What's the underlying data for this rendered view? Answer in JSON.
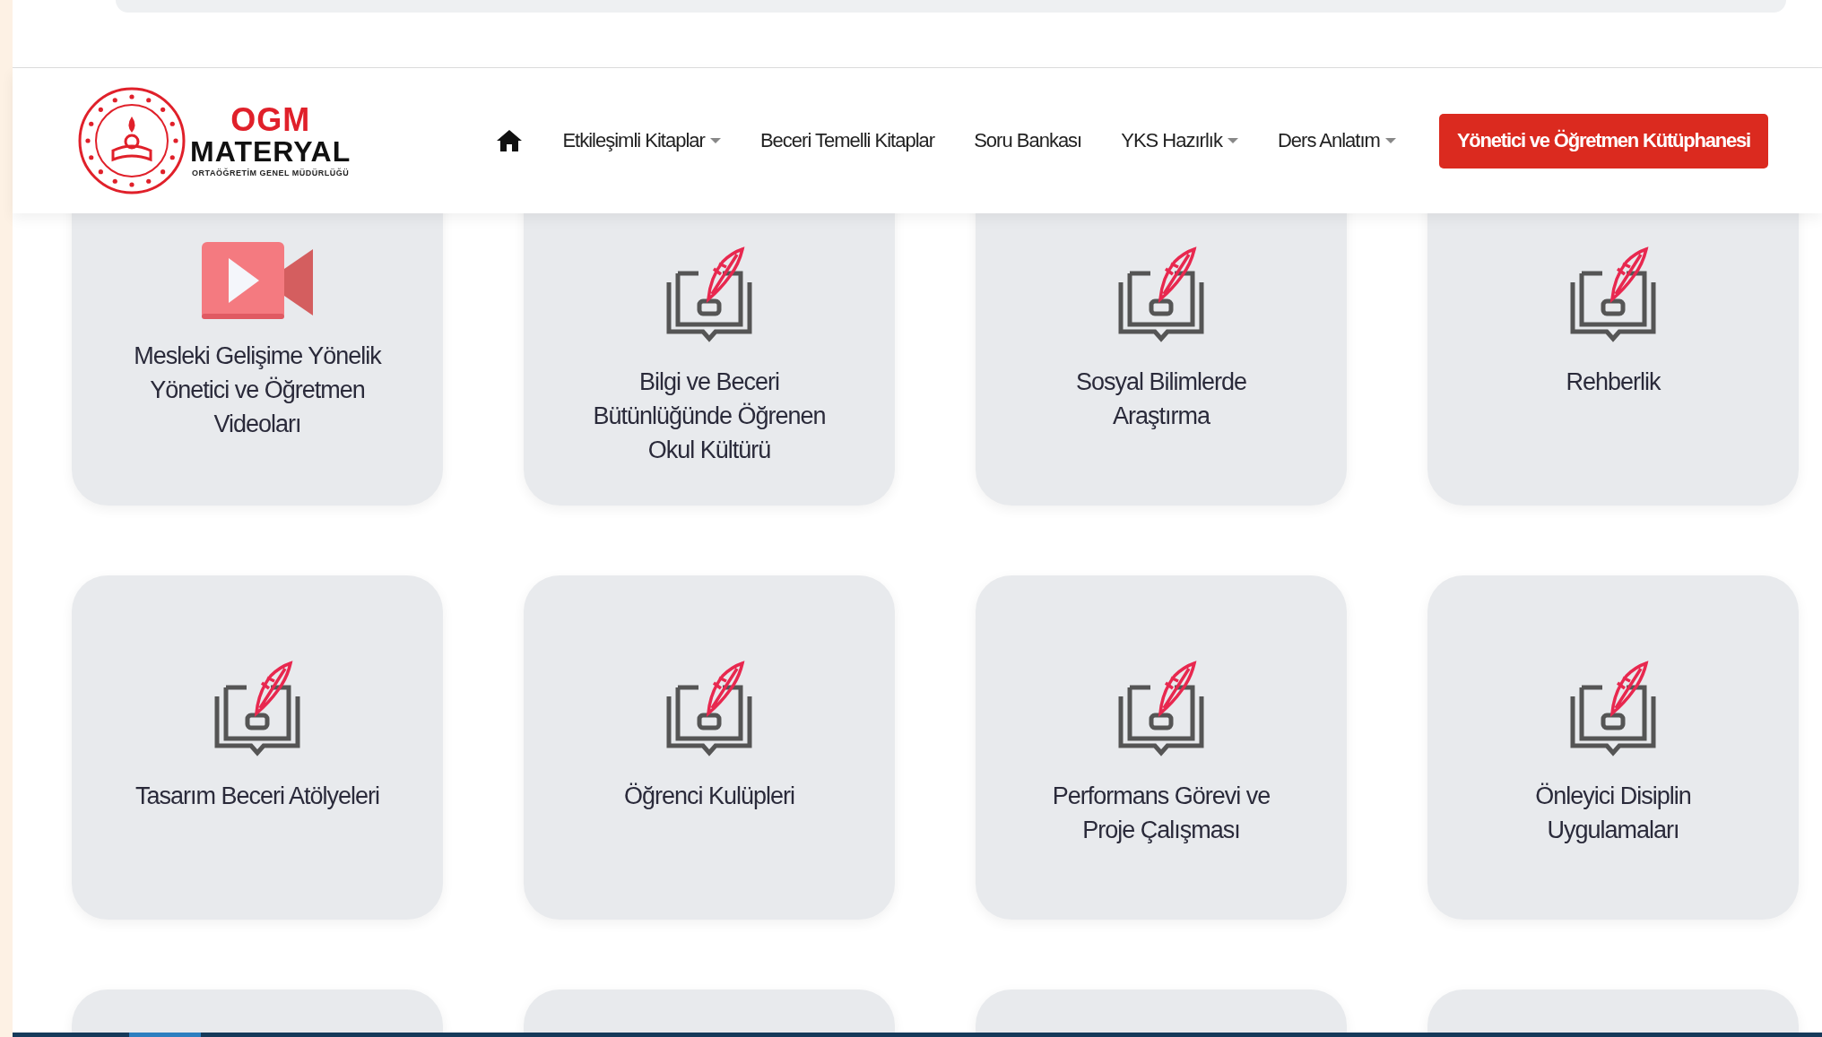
{
  "logo": {
    "title": "OGM",
    "subtitle": "MATERYAL",
    "tagline": "ORTAÖĞRETİM GENEL MÜDÜRLÜĞÜ"
  },
  "nav": [
    {
      "kind": "home"
    },
    {
      "kind": "link",
      "label": "Etkileşimli Kitaplar",
      "dropdown": true
    },
    {
      "kind": "link",
      "label": "Beceri Temelli Kitaplar",
      "dropdown": false
    },
    {
      "kind": "link",
      "label": "Soru Bankası",
      "dropdown": false
    },
    {
      "kind": "link",
      "label": "YKS Hazırlık",
      "dropdown": true
    },
    {
      "kind": "link",
      "label": "Ders Anlatım",
      "dropdown": true
    }
  ],
  "cta": "Yönetici ve Öğretmen Kütüphanesi",
  "cards": [
    {
      "kind": "video",
      "title": "Mesleki Gelişime Yönelik Yönetici ve Öğretmen Videoları"
    },
    {
      "kind": "book",
      "title": "Bilgi ve Beceri Bütünlüğünde Öğrenen Okul Kültürü"
    },
    {
      "kind": "book",
      "title": "Sosyal Bilimlerde Araştırma"
    },
    {
      "kind": "book",
      "title": "Rehberlik"
    },
    {
      "kind": "book",
      "title": "Tasarım Beceri Atölyeleri"
    },
    {
      "kind": "book",
      "title": "Öğrenci Kulüpleri"
    },
    {
      "kind": "book",
      "title": "Performans Görevi ve Proje Çalışması"
    },
    {
      "kind": "book",
      "title": "Önleyici Disiplin Uygulamaları"
    }
  ]
}
